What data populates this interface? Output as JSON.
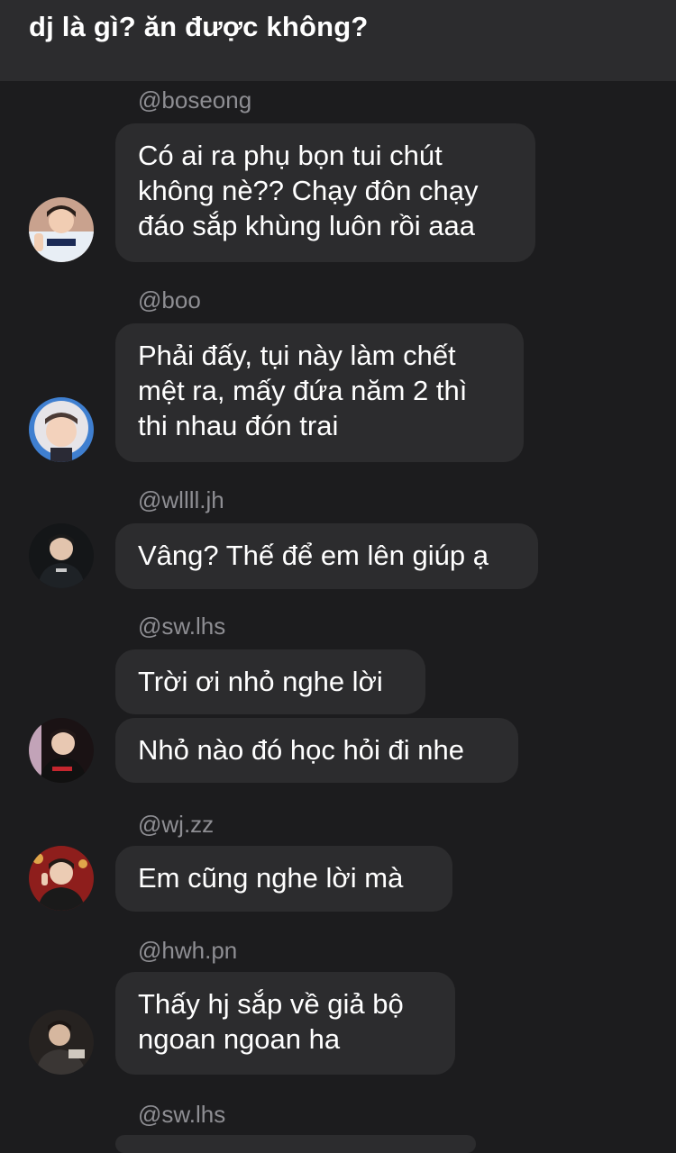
{
  "header": {
    "title": "dj là gì? ăn được không?"
  },
  "messages": [
    {
      "username": "@boseong",
      "bubbles": [
        "Có ai ra phụ bọn tui chút\nkhông nè?? Chạy đôn chạy\nđáo sắp khùng luôn rồi aaa"
      ],
      "avatar": "avatar-boseong"
    },
    {
      "username": "@boo",
      "bubbles": [
        "Phải đấy, tụi này làm chết\nmệt ra, mấy đứa năm 2 thì\nthi nhau đón trai"
      ],
      "avatar": "avatar-boo"
    },
    {
      "username": "@wllll.jh",
      "bubbles": [
        "Vâng? Thế để em lên giúp ạ"
      ],
      "avatar": "avatar-wllll"
    },
    {
      "username": "@sw.lhs",
      "bubbles": [
        "Trời ơi nhỏ nghe lời",
        "Nhỏ nào đó học hỏi đi nhe"
      ],
      "avatar": "avatar-swlhs"
    },
    {
      "username": "@wj.zz",
      "bubbles": [
        "Em cũng nghe lời mà"
      ],
      "avatar": "avatar-wjzz"
    },
    {
      "username": "@hwh.pn",
      "bubbles": [
        "Thấy hj sắp về giả bộ\nngoan ngoan ha"
      ],
      "avatar": "avatar-hwhpn"
    },
    {
      "username": "@sw.lhs",
      "bubbles": [],
      "avatar": null
    }
  ],
  "colors": {
    "background": "#1c1c1e",
    "header": "#2c2c2e",
    "bubble": "#2c2c2e",
    "username": "#8e8e93",
    "text": "#ffffff"
  }
}
